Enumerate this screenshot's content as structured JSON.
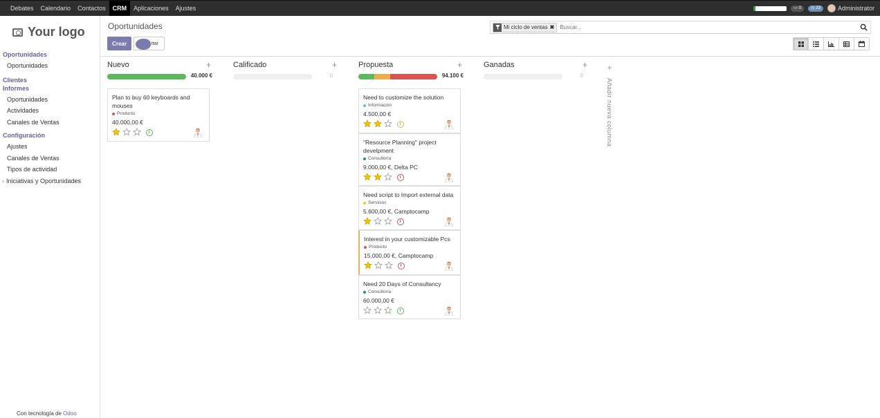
{
  "topbar": {
    "menu": [
      "Debates",
      "Calendario",
      "Contactos",
      "CRM",
      "Aplicaciones",
      "Ajustes"
    ],
    "active": "CRM",
    "chat_count": "0",
    "activity_count": "23",
    "user": "Administrator"
  },
  "sidebar": {
    "logo": "Your logo",
    "sections": [
      {
        "title": "Oportunidades",
        "items": [
          "Oportunidades"
        ]
      },
      {
        "title": "Clientes",
        "items": []
      },
      {
        "title": "Informes",
        "items": [
          "Oportunidades",
          "Actividades",
          "Canales de Ventas"
        ]
      },
      {
        "title": "Configuración",
        "items": [
          "Ajustes",
          "Canales de Ventas",
          "Tipos de actividad"
        ]
      }
    ],
    "submenu": "Iniciativas y Oportunidades",
    "powered_prefix": "Con tecnología de",
    "powered_brand": "Odoo"
  },
  "control": {
    "breadcrumb": "Oportunidades",
    "create": "Crear",
    "import": "Importar",
    "import_visible": "rtar",
    "facet": "Mi ciclo de ventas",
    "search_placeholder": "Buscar..."
  },
  "colors": {
    "accent": "#7c7bad",
    "green": "#5cb85c",
    "orange": "#f0ad4e",
    "red": "#d9534f",
    "star": "#f3c600"
  },
  "columns": [
    {
      "title": "Nuevo",
      "total": "40.000 €",
      "bar": [
        {
          "color": "#5cb85c",
          "fraction": 1.0
        }
      ],
      "cards": [
        {
          "title": "Plan to buy 60 keyboards and mouses",
          "tag": "Producto",
          "tag_color": "#d9534f",
          "amount": "40.000,00 €",
          "stars": 1,
          "activity": "green"
        }
      ]
    },
    {
      "title": "Calificado",
      "total": "0",
      "bar": [],
      "cards": []
    },
    {
      "title": "Propuesta",
      "total": "94.100 €",
      "bar": [
        {
          "color": "#5cb85c",
          "fraction": 0.2
        },
        {
          "color": "#f0ad4e",
          "fraction": 0.2
        },
        {
          "color": "#d9534f",
          "fraction": 0.6
        }
      ],
      "cards": [
        {
          "title": "Need to customize the solution",
          "tag": "Información",
          "tag_color": "#5bc0de",
          "amount": "4.500,00 €",
          "stars": 2,
          "activity": "orange"
        },
        {
          "title": "\"Resource Planning\" project develpment",
          "tag": "Consultoría",
          "tag_color": "#2a8b8f",
          "amount": "9.000,00 €, Delta PC",
          "stars": 2,
          "activity": "red"
        },
        {
          "title": "Need script to Import external data",
          "tag": "Servicios",
          "tag_color": "#f0d000",
          "amount": "5.600,00 €, Camptocamp",
          "stars": 1,
          "activity": "red"
        },
        {
          "title": "Interest in your customizable Pcs",
          "tag": "Producto",
          "tag_color": "#d9534f",
          "amount": "15.000,00 €, Camptocamp",
          "stars": 1,
          "activity": "red",
          "highlight": true
        },
        {
          "title": "Need 20 Days of Consultancy",
          "tag": "Consultoría",
          "tag_color": "#2a8b8f",
          "amount": "60.000,00 €",
          "stars": 0,
          "activity": "green"
        }
      ]
    },
    {
      "title": "Ganadas",
      "total": "0",
      "bar": [],
      "cards": []
    }
  ],
  "add_column": "Añadir nueva columna"
}
